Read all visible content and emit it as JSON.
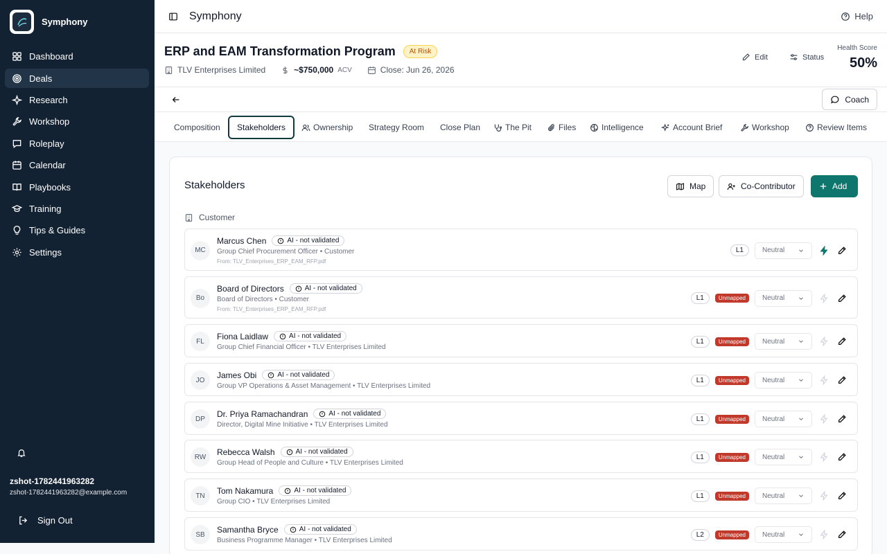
{
  "app": {
    "name": "Symphony"
  },
  "sidebar": {
    "items": [
      {
        "label": "Dashboard",
        "icon": "grid-icon"
      },
      {
        "label": "Deals",
        "icon": "target-icon",
        "active": true
      },
      {
        "label": "Research",
        "icon": "sparkle-icon"
      },
      {
        "label": "Workshop",
        "icon": "wrench-icon"
      },
      {
        "label": "Roleplay",
        "icon": "chat-icon"
      },
      {
        "label": "Calendar",
        "icon": "calendar-icon"
      },
      {
        "label": "Playbooks",
        "icon": "book-icon"
      },
      {
        "label": "Training",
        "icon": "graduation-cap-icon"
      },
      {
        "label": "Tips & Guides",
        "icon": "lightbulb-icon"
      },
      {
        "label": "Settings",
        "icon": "gear-icon"
      }
    ],
    "user": {
      "name": "zshot-1782441963282",
      "email": "zshot-1782441963282@example.com"
    },
    "signout_label": "Sign Out"
  },
  "topbar": {
    "title": "Symphony",
    "help_label": "Help"
  },
  "deal": {
    "title": "ERP and EAM Transformation Program",
    "status_badge": "At Risk",
    "company": "TLV Enterprises Limited",
    "acv_value": "~$750,000",
    "acv_label": "ACV",
    "close": "Close: Jun 26, 2026",
    "edit_label": "Edit",
    "status_label": "Status",
    "health_label": "Health Score",
    "health_value": "50%"
  },
  "coach_label": "Coach",
  "tabs": [
    "Composition",
    "Stakeholders",
    "Ownership",
    "Strategy Room",
    "Close Plan",
    "The Pit",
    "Files",
    "Intelligence",
    "Account Brief",
    "Workshop",
    "Review Items"
  ],
  "stakeholders": {
    "title": "Stakeholders",
    "map_label": "Map",
    "cocontributor_label": "Co-Contributor",
    "add_label": "Add",
    "section_label": "Customer",
    "ai_badge": "AI - not validated",
    "stance_label": "Neutral",
    "unmapped_label": "Unmapped",
    "rows": [
      {
        "initials": "MC",
        "name": "Marcus Chen",
        "role": "Group Chief Procurement Officer • Customer",
        "source": "From: TLV_Enterprises_ERP_EAM_RFP.pdf",
        "level": "L1",
        "unmapped": false,
        "bolt_active": true
      },
      {
        "initials": "Bo",
        "name": "Board of Directors",
        "role": "Board of Directors • Customer",
        "source": "From: TLV_Enterprises_ERP_EAM_RFP.pdf",
        "level": "L1",
        "unmapped": true,
        "bolt_active": false
      },
      {
        "initials": "FL",
        "name": "Fiona Laidlaw",
        "role": "Group Chief Financial Officer • TLV Enterprises Limited",
        "level": "L1",
        "unmapped": true,
        "bolt_active": false
      },
      {
        "initials": "JO",
        "name": "James Obi",
        "role": "Group VP Operations & Asset Management • TLV Enterprises Limited",
        "level": "L1",
        "unmapped": true,
        "bolt_active": false
      },
      {
        "initials": "DP",
        "name": "Dr. Priya Ramachandran",
        "role": "Director, Digital Mine Initiative • TLV Enterprises Limited",
        "level": "L1",
        "unmapped": true,
        "bolt_active": false
      },
      {
        "initials": "RW",
        "name": "Rebecca Walsh",
        "role": "Group Head of People and Culture • TLV Enterprises Limited",
        "level": "L1",
        "unmapped": true,
        "bolt_active": false
      },
      {
        "initials": "TN",
        "name": "Tom Nakamura",
        "role": "Group CIO • TLV Enterprises Limited",
        "level": "L1",
        "unmapped": true,
        "bolt_active": false
      },
      {
        "initials": "SB",
        "name": "Samantha Bryce",
        "role": "Business Programme Manager • TLV Enterprises Limited",
        "level": "L2",
        "unmapped": true,
        "bolt_active": false
      }
    ]
  }
}
